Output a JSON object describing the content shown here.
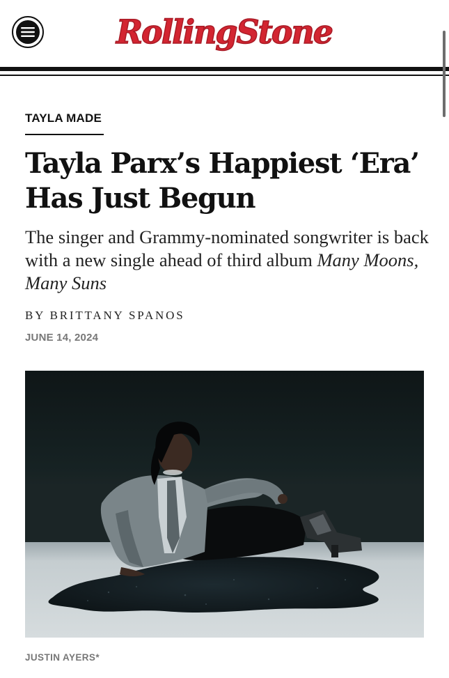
{
  "site": {
    "logo_text": "RollingStone",
    "brand_color": "#d32531"
  },
  "header": {
    "menu_icon": "hamburger-menu-icon"
  },
  "article": {
    "kicker": "TAYLA MADE",
    "title": "Tayla Parx’s Happiest ‘Era’ Has Just Begun",
    "dek_plain": "The singer and Grammy-nominated songwriter is back with a new single ahead of third album",
    "dek_italic": "Many Moons, Many Suns",
    "byline": "BY BRITTANY SPANOS",
    "date": "JUNE 14, 2024",
    "photo_credit": "JUSTIN AYERS*"
  }
}
